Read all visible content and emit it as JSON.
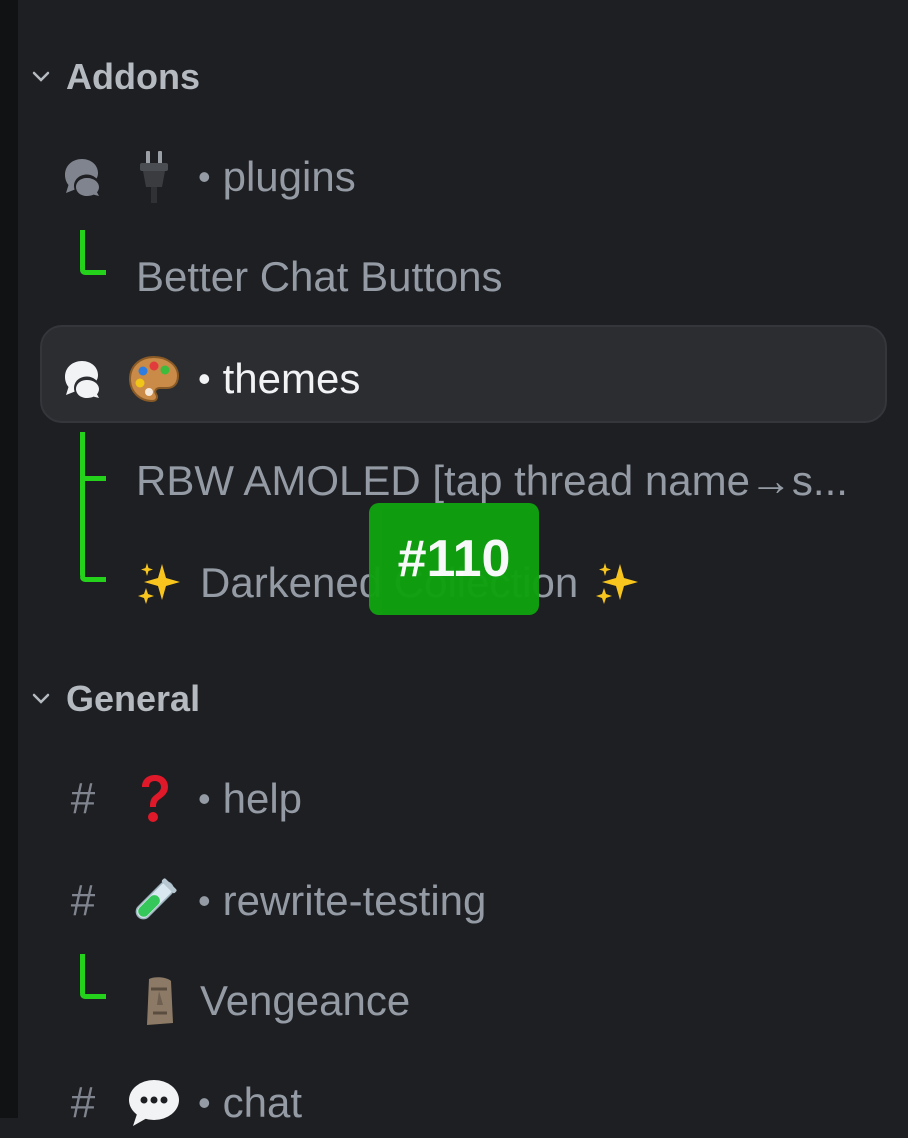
{
  "categories": {
    "addons": {
      "label": "Addons"
    },
    "general": {
      "label": "General"
    }
  },
  "channels": {
    "plugins": {
      "name": "plugins",
      "emoji": "plug-emoji",
      "type": "forum"
    },
    "themes": {
      "name": "themes",
      "emoji": "palette-emoji",
      "type": "forum",
      "selected": true
    },
    "help": {
      "name": "help",
      "emoji": "question-mark-emoji",
      "type": "text"
    },
    "rewrite_testing": {
      "name": "rewrite-testing",
      "emoji": "test-tube-emoji",
      "type": "text"
    },
    "chat": {
      "name": "chat",
      "emoji": "speech-bubble-emoji",
      "type": "text"
    }
  },
  "threads": {
    "better_chat_buttons": "Better Chat Buttons",
    "rbw_amoled": "RBW AMOLED [tap thread name→s...",
    "darkened_collection": "Darkened Collection",
    "vengeance": "Vengeance"
  },
  "separator": "•",
  "hash": "#",
  "overlay_badge": {
    "label": "#110",
    "color": "#0fa20f"
  },
  "colors": {
    "background": "#1e1f22",
    "selected_row": "#2b2d31",
    "muted_text": "#949ba4",
    "active_text": "#f2f3f5",
    "connector": "#24d11b"
  }
}
